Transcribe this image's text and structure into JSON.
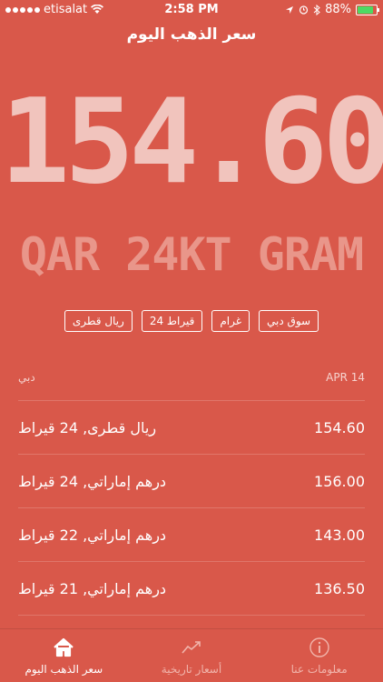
{
  "status_bar": {
    "carrier": "etisalat",
    "time": "2:58 PM",
    "battery": "88%",
    "battery_level": 0.88
  },
  "header": {
    "title": "سعر الذهب اليوم"
  },
  "hero": {
    "price": "154.60",
    "unit": "QAR 24KT GRAM"
  },
  "filters": [
    "ريال قطرى",
    "قيراط 24",
    "غرام",
    "سوق دبي"
  ],
  "section": {
    "date": "APR 14",
    "market": "دبي"
  },
  "prices": [
    {
      "label": "ريال قطرى, 24 قيراط",
      "value": "154.60"
    },
    {
      "label": "درهم إماراتي, 24 قيراط",
      "value": "156.00"
    },
    {
      "label": "درهم إماراتي, 22 قيراط",
      "value": "143.00"
    },
    {
      "label": "درهم إماراتي, 21 قيراط",
      "value": "136.50"
    }
  ],
  "tabs": [
    {
      "label": "سعر الذهب اليوم",
      "icon": "home-icon"
    },
    {
      "label": "أسعار تاريخية",
      "icon": "trend-icon"
    },
    {
      "label": "معلومات عنا",
      "icon": "info-icon"
    }
  ],
  "colors": {
    "background": "#d9584a",
    "price_big": "#f1c4bd",
    "unit_text": "#e9968a",
    "battery": "#4cd964"
  }
}
